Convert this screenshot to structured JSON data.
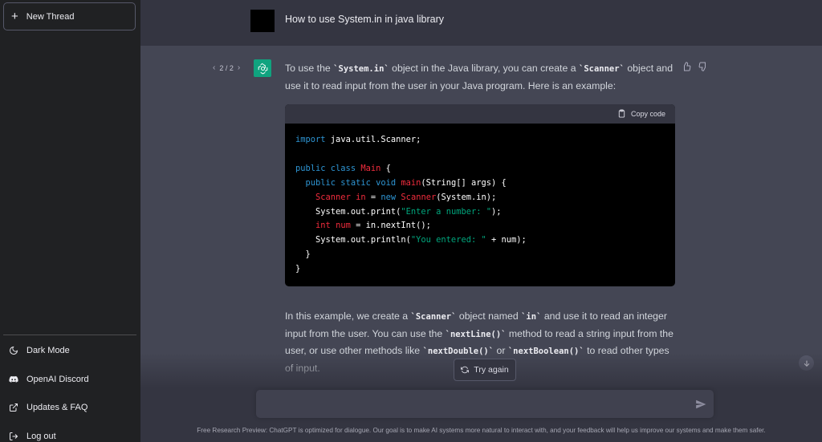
{
  "sidebar": {
    "new_thread": "New Thread",
    "items": [
      {
        "label": "Dark Mode",
        "icon": "moon-icon"
      },
      {
        "label": "OpenAI Discord",
        "icon": "discord-icon"
      },
      {
        "label": "Updates & FAQ",
        "icon": "external-link-icon"
      },
      {
        "label": "Log out",
        "icon": "logout-icon"
      }
    ]
  },
  "conversation": {
    "user_message": "How to use System.in in java library",
    "pager": "2 / 2",
    "intro": {
      "p1": "To use the ",
      "c1": "`System.in`",
      "p2": " object in the Java library, you can create a ",
      "c2": "`Scanner`",
      "p3": " object and use it to read input from the user in your Java program. Here is an example:"
    },
    "code": {
      "copy_label": "Copy code",
      "l1_kw": "import",
      "l1_rest": " java.util.Scanner;",
      "l3_kw": "public class",
      "l3_ty": "Main",
      "l3_rest": " {",
      "l4_kw": "public static void",
      "l4_fn": "main",
      "l4_rest": "(String[] args) {",
      "l5_ty": "Scanner",
      "l5_var": " in",
      "l5_mid": " = ",
      "l5_kw": "new",
      "l5_ty2": " Scanner",
      "l5_rest": "(System.in);",
      "l6_a": "System.out.print(",
      "l6_str": "\"Enter a number: \"",
      "l6_b": ");",
      "l7_ty": "int",
      "l7_var": " num",
      "l7_rest": " = in.nextInt();",
      "l8_a": "System.out.println(",
      "l8_str": "\"You entered: \"",
      "l8_b": " + num);",
      "l9": "}",
      "l10": "}"
    },
    "explanation": {
      "p1": "In this example, we create a ",
      "c1": "`Scanner`",
      "p2": " object named ",
      "c2": "`in`",
      "p3": " and use it to read an integer input from the user. You can use the ",
      "c3": "`nextLine()`",
      "p4": " method to read a string input from the user, or use other methods like ",
      "c4": "`nextDouble()`",
      "p5": " or ",
      "c5": "`nextBoolean()`",
      "p6": " to read other types of input."
    }
  },
  "composer": {
    "try_again": "Try again",
    "input_value": "",
    "footer": "Free Research Preview: ChatGPT is optimized for dialogue. Our goal is to make AI systems more natural to interact with, and your feedback will help us improve our systems and make them safer."
  },
  "colors": {
    "sidebar_bg": "#202123",
    "main_bg": "#343541",
    "assistant_bg": "#444654",
    "gpt_avatar": "#10a37f",
    "keyword": "#2e95d3",
    "type": "#f22c3d",
    "string": "#00a67d"
  }
}
